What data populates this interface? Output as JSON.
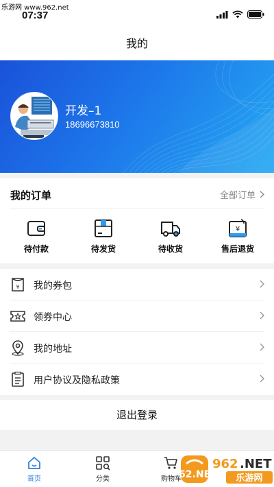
{
  "watermark_top": "乐游网 www.962.net",
  "status": {
    "time": "07:37"
  },
  "header": {
    "title": "我的"
  },
  "profile": {
    "name": "开发–1",
    "phone": "18696673810"
  },
  "orders": {
    "title": "我的订单",
    "all_label": "全部订单",
    "items": [
      {
        "label": "待付款",
        "icon": "wallet-icon"
      },
      {
        "label": "待发货",
        "icon": "package-icon"
      },
      {
        "label": "待收货",
        "icon": "truck-icon"
      },
      {
        "label": "售后退货",
        "icon": "refund-icon"
      }
    ]
  },
  "menu": {
    "items": [
      {
        "label": "我的券包",
        "icon": "coupon-bag-icon"
      },
      {
        "label": "领券中心",
        "icon": "ticket-icon"
      },
      {
        "label": "我的地址",
        "icon": "location-icon"
      },
      {
        "label": "用户协议及隐私政策",
        "icon": "document-icon"
      }
    ]
  },
  "logout": {
    "label": "退出登录"
  },
  "tabbar": {
    "items": [
      {
        "label": "首页",
        "icon": "home-icon",
        "active": true
      },
      {
        "label": "分类",
        "icon": "category-icon",
        "active": false
      },
      {
        "label": "购物车",
        "icon": "cart-icon",
        "active": false
      }
    ]
  },
  "watermark_logo": {
    "brand": "962.NET",
    "text": "乐游网"
  },
  "colors": {
    "accent": "#2f7de1",
    "banner_start": "#1a52d9",
    "banner_end": "#25a9f2",
    "logo_orange": "#f39a1e"
  }
}
